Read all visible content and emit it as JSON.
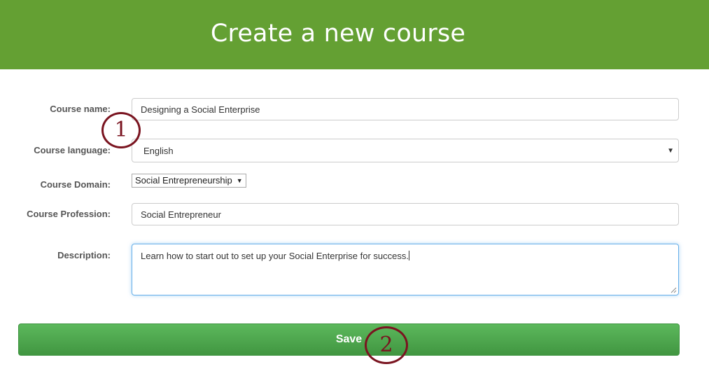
{
  "header": {
    "title": "Create a new course"
  },
  "form": {
    "course_name": {
      "label": "Course name:",
      "value": "Designing a Social Enterprise"
    },
    "course_language": {
      "label": "Course language:",
      "selected": "English"
    },
    "course_domain": {
      "label": "Course Domain:",
      "selected": "Social Entrepreneurship"
    },
    "course_profession": {
      "label": "Course Profession:",
      "value": "Social Entrepreneur"
    },
    "description": {
      "label": "Description:",
      "value": "Learn how to start out to set up your Social Enterprise for success."
    }
  },
  "save_button": {
    "label": "Save"
  },
  "annotations": {
    "marker_1": "1",
    "marker_2": "2",
    "color": "#7a1420"
  },
  "colors": {
    "header_bg": "#64a033",
    "save_bg": "#5cb85c",
    "focus_border": "#66afe9"
  },
  "icons": {
    "select_arrow": "caret-down-icon",
    "resize": "resize-grip-icon"
  }
}
